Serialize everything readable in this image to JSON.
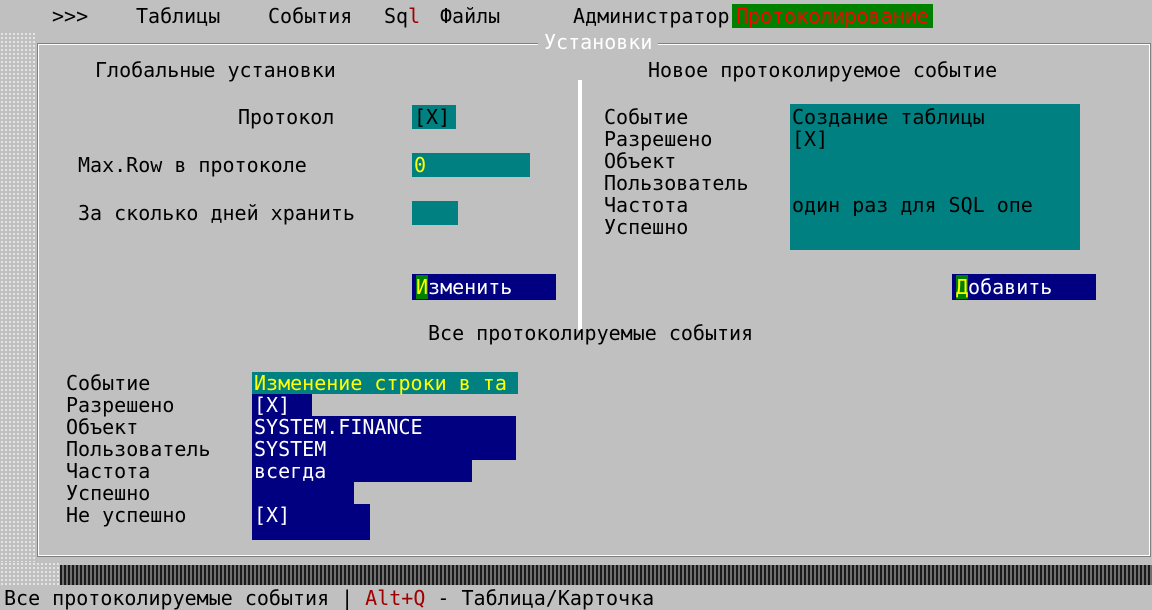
{
  "menu": {
    "items": [
      "Таблицы",
      "События",
      "Файлы",
      "Администратор"
    ],
    "prompt": ">>>",
    "sql_prefix": "Sq",
    "sql_suffix": "l",
    "active": "Протоколирование"
  },
  "window": {
    "title": "Установки"
  },
  "global": {
    "heading": "Глобальные установки",
    "protocol_label": "Протокол",
    "protocol_value": "[X]",
    "maxrow_label": "Max.Row в протоколе",
    "maxrow_value": "0",
    "days_label": "За сколько дней хранить",
    "days_value": "",
    "change_button_hot": "И",
    "change_button_rest": "зменить"
  },
  "new_event": {
    "heading": "Новое протоколируемое событие",
    "labels": [
      "Событие",
      "Разрешено",
      "Объект",
      "Пользователь",
      "Частота",
      "Успешно"
    ],
    "event_value": "Создание таблицы",
    "allowed_value": "[X]",
    "frequency_value": "один раз для SQL опе",
    "add_button_hot": "Д",
    "add_button_rest": "обавить"
  },
  "all_events": {
    "heading": "Все протоколируемые события",
    "labels": [
      "Событие",
      "Разрешено",
      "Объект",
      "Пользователь",
      "Частота",
      "Успешно",
      "Не успешно"
    ],
    "event_value": "Изменение строки в та",
    "allowed_value": "[X]",
    "object_value": "SYSTEM.FINANCE",
    "user_value": "SYSTEM",
    "frequency_value": "всегда",
    "success_value": "",
    "fail_value": "[X]"
  },
  "status": {
    "text": "Все протоколируемые события",
    "separator": "|",
    "key": "Alt+Q",
    "hint": " - Таблица/Карточка"
  },
  "colors": {
    "background": "#c0c0c0",
    "teal": "#008080",
    "navy": "#000080",
    "active_menu": "#008000",
    "hotkey": "#a00000",
    "highlight_text": "#ffff00"
  }
}
